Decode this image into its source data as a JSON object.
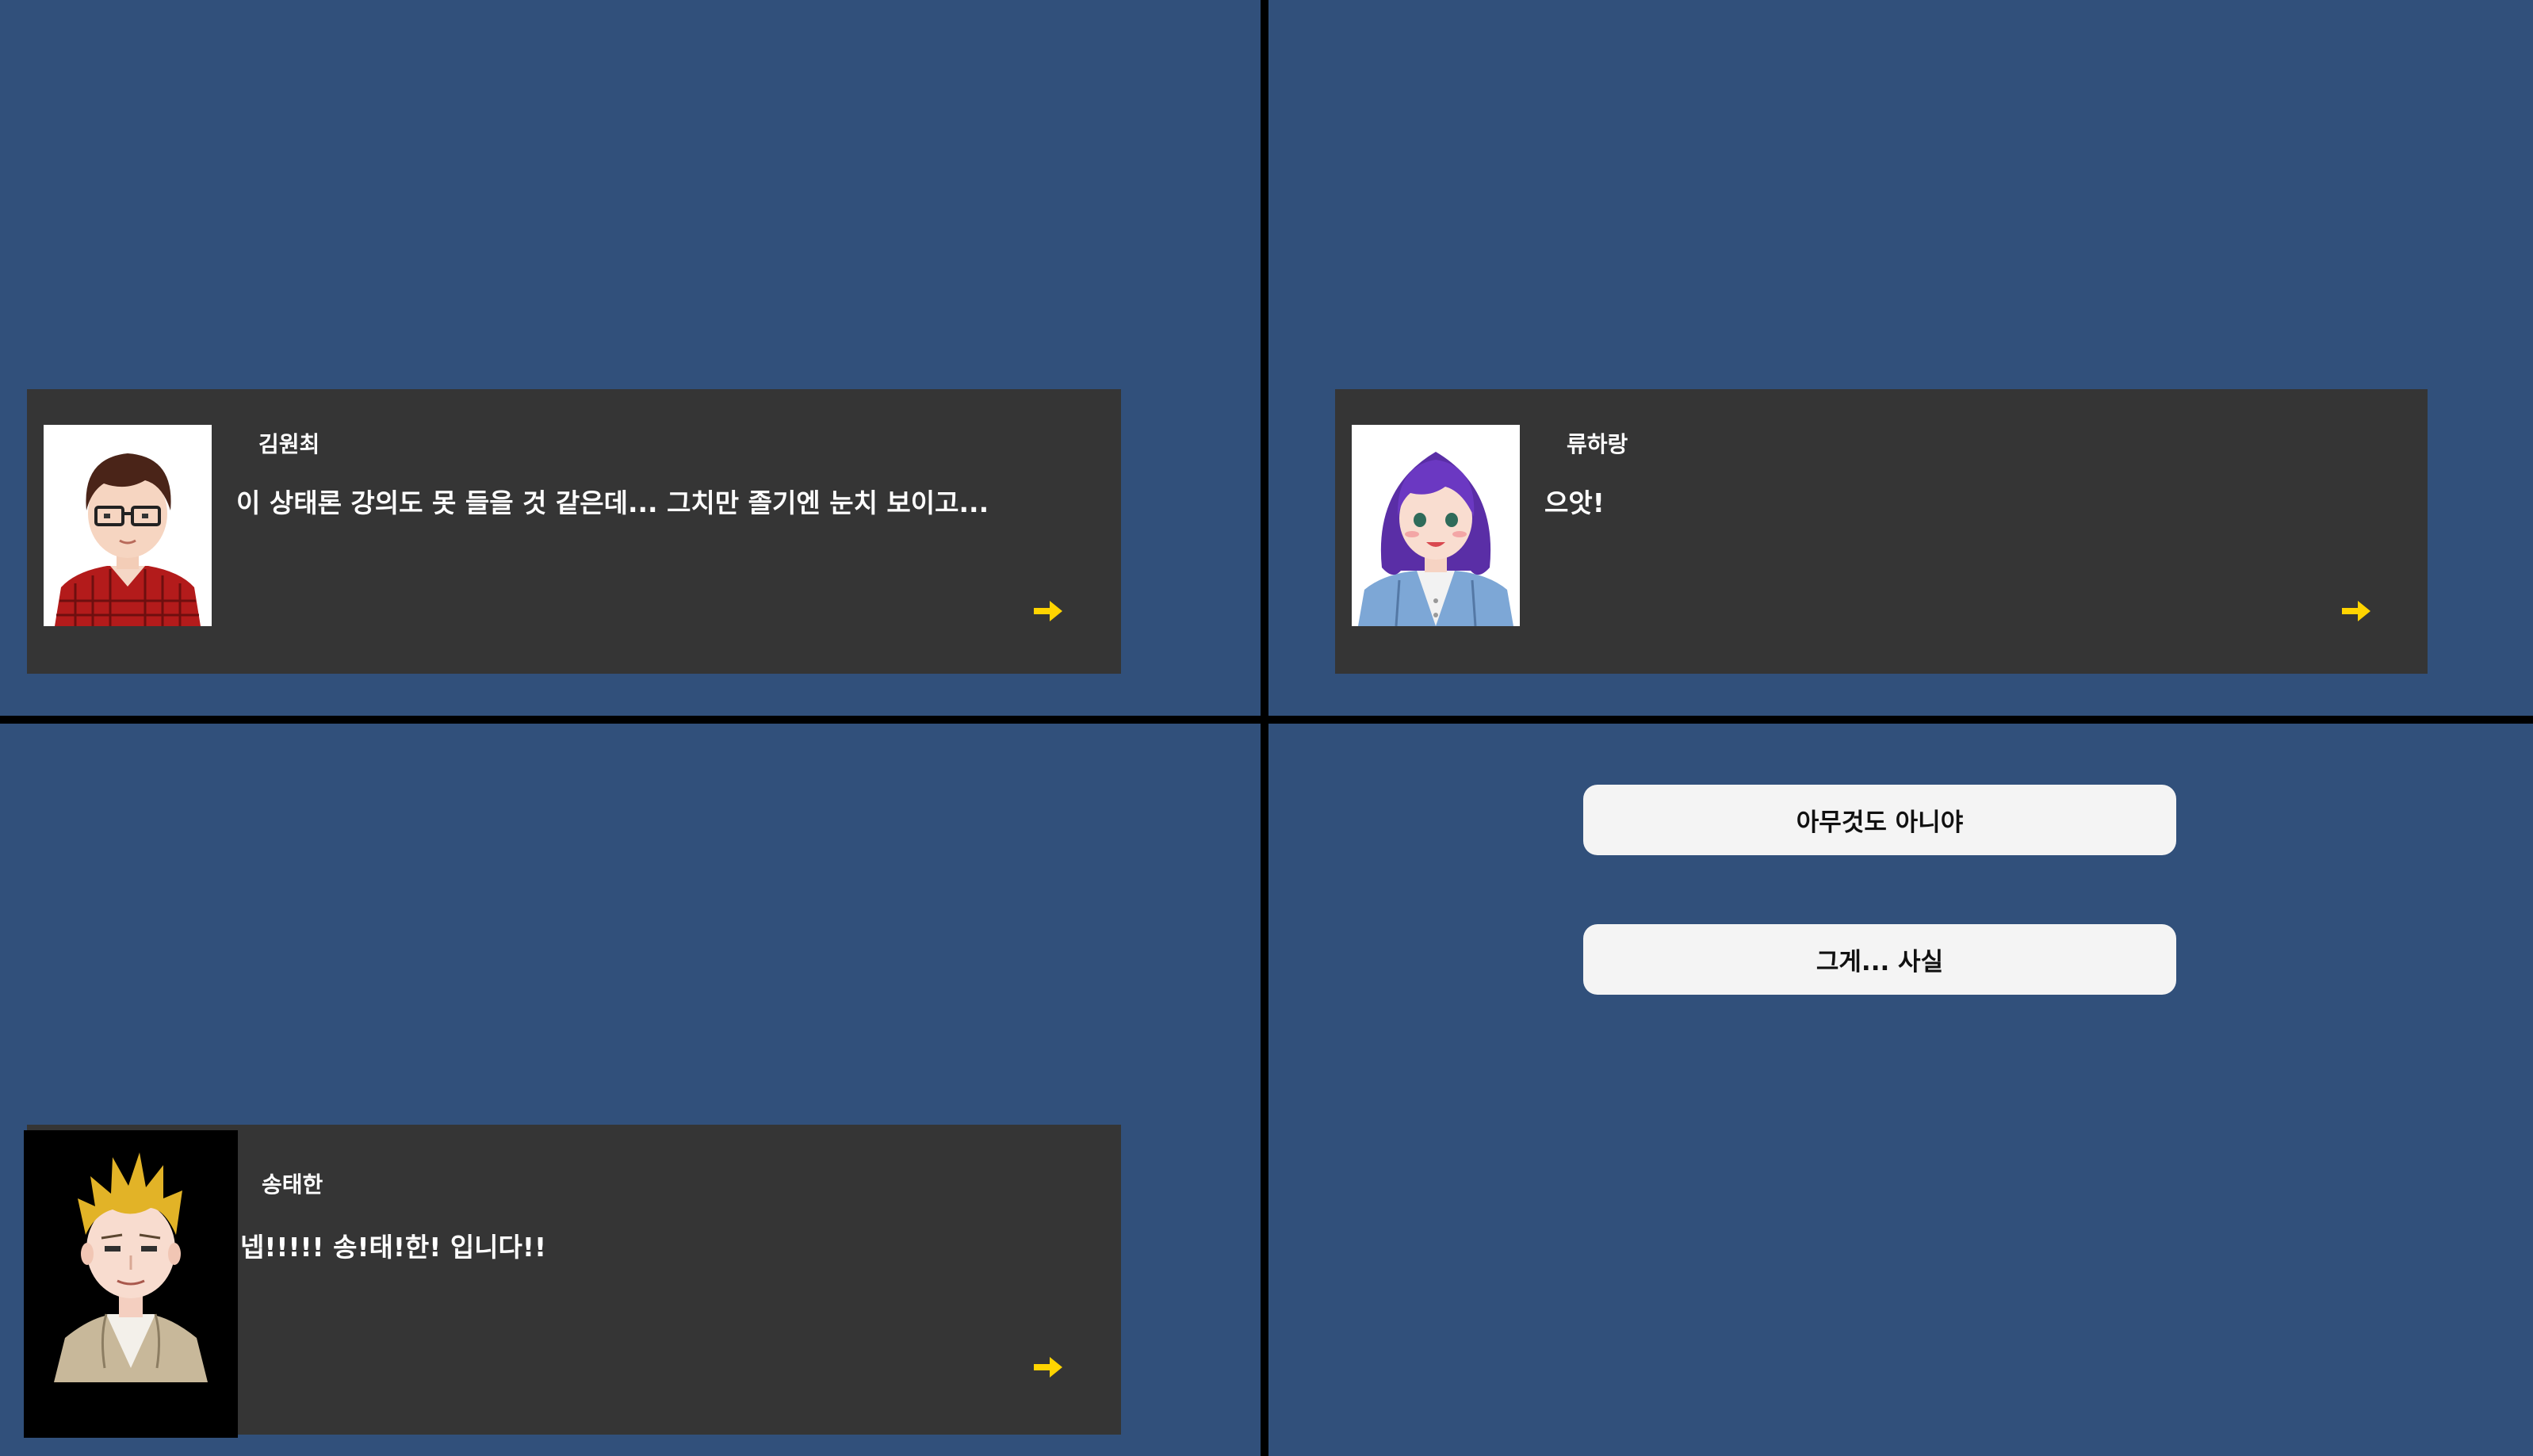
{
  "colors": {
    "background": "#31507b",
    "divider": "#000000",
    "dialog_box": "#353535",
    "text": "#ffffff",
    "arrow": "#ffd400",
    "choice_button": "#f4f4f4"
  },
  "panels": {
    "top_left": {
      "speaker": "김원최",
      "text": "이 상태론 강의도 못 들을 것 같은데... 그치만 졸기엔 눈치 보이고...",
      "portrait_icon": "brown-hair-glasses-boy-portrait",
      "next_icon": "right-arrow-icon"
    },
    "top_right": {
      "speaker": "류하랑",
      "text": "으앗!",
      "portrait_icon": "purple-hair-girl-portrait",
      "next_icon": "right-arrow-icon"
    },
    "bottom_left": {
      "speaker": "송태한",
      "text": "넵!!!!! 송!태!한! 입니다!!",
      "portrait_icon": "blonde-spiky-hair-boy-portrait",
      "next_icon": "right-arrow-icon"
    },
    "bottom_right": {
      "choices": [
        {
          "label": "아무것도 아니야"
        },
        {
          "label": "그게... 사실"
        }
      ]
    }
  }
}
